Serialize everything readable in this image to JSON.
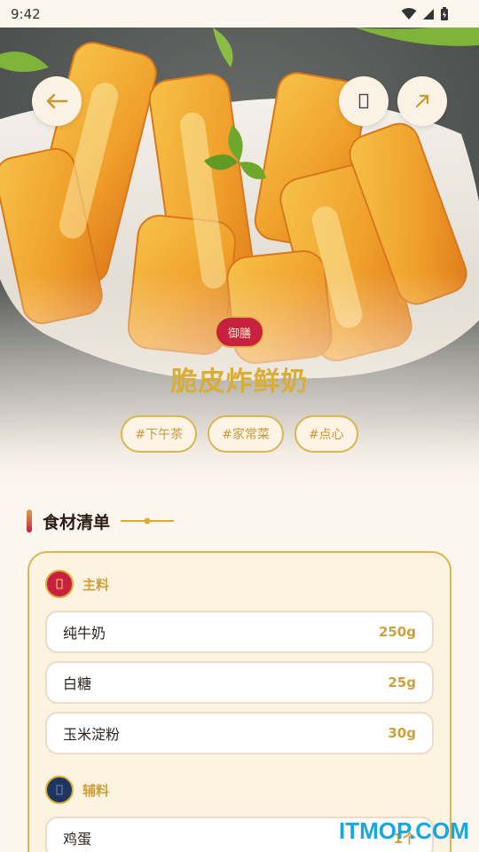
{
  "status_bar": {
    "time": "9:42"
  },
  "hero": {
    "badge": "御膳",
    "title": "脆皮炸鲜奶",
    "tags": [
      "#下午茶",
      "#家常菜",
      "#点心"
    ],
    "back_icon": "arrow-left-icon",
    "favorite_icon": "bookmark-icon",
    "share_icon": "arrow-up-right-icon"
  },
  "ingredients": {
    "section_title": "食材清单",
    "groups": [
      {
        "label": "主料",
        "icon_color": "#c8203f",
        "items": [
          {
            "name": "纯牛奶",
            "amount": "250g"
          },
          {
            "name": "白糖",
            "amount": "25g"
          },
          {
            "name": "玉米淀粉",
            "amount": "30g"
          }
        ]
      },
      {
        "label": "辅料",
        "icon_color": "#1e3560",
        "items": [
          {
            "name": "鸡蛋",
            "amount": "1个"
          }
        ]
      }
    ]
  },
  "watermark": "ITMOP.COM",
  "colors": {
    "accent": "#d9ae38",
    "red": "#c8203f",
    "navy": "#1e3560",
    "background": "#fdf6ee"
  }
}
